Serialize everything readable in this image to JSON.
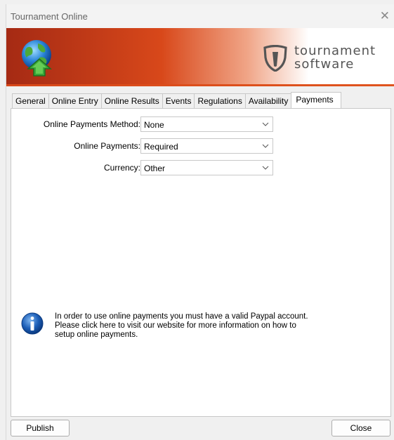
{
  "window": {
    "title": "Tournament Online",
    "close_glyph": "✕"
  },
  "banner": {
    "globe_icon": "globe-upload-icon",
    "brand_line1": "tournament",
    "brand_line2": "software",
    "brand_icon": "shield-logo-icon"
  },
  "tabs": [
    {
      "label": "General",
      "active": false
    },
    {
      "label": "Online Entry",
      "active": false
    },
    {
      "label": "Online Results",
      "active": false
    },
    {
      "label": "Events",
      "active": false
    },
    {
      "label": "Regulations",
      "active": false
    },
    {
      "label": "Availability",
      "active": false
    },
    {
      "label": "Payments",
      "active": true
    }
  ],
  "form": {
    "method": {
      "label": "Online Payments Method:",
      "value": "None"
    },
    "payments": {
      "label": "Online Payments:",
      "value": "Required"
    },
    "currency": {
      "label": "Currency:",
      "value": "Other"
    }
  },
  "info": {
    "icon": "info-icon",
    "line1": "In order to use online payments you must have a valid Paypal account.",
    "line2": "Please click here to visit our website for more information on how to",
    "line3": "setup online payments."
  },
  "buttons": {
    "publish": "Publish",
    "close": "Close"
  },
  "colors": {
    "banner_dark": "#a52a14",
    "banner_accent": "#d8481a",
    "info_blue": "#1d5fb8"
  }
}
